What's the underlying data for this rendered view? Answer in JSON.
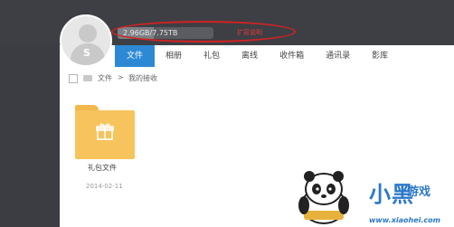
{
  "header": {
    "capacity_text": "2.96GB/7.75TB",
    "capacity_fraction": 0.38,
    "upgrade_link": "扩容说明",
    "avatar_glyph": "S"
  },
  "tabs": [
    {
      "label": "文件",
      "active": true
    },
    {
      "label": "相册",
      "active": false
    },
    {
      "label": "礼包",
      "active": false
    },
    {
      "label": "离线",
      "active": false
    },
    {
      "label": "收件箱",
      "active": false
    },
    {
      "label": "通讯录",
      "active": false
    },
    {
      "label": "影库",
      "active": false
    }
  ],
  "breadcrumb": {
    "root": "文件",
    "separator": ">",
    "current": "我的接收"
  },
  "folder": {
    "name": "礼包文件",
    "date": "2014-02-11",
    "icon": "gift-folder-icon"
  },
  "watermark": {
    "title": "小黑",
    "game": "游戏",
    "url": "www.xiaohei.com",
    "mascot": "panda-mascot-icon"
  },
  "colors": {
    "accent": "#2d89d6",
    "highlight": "#d32222",
    "folder": "#f7c35c"
  }
}
